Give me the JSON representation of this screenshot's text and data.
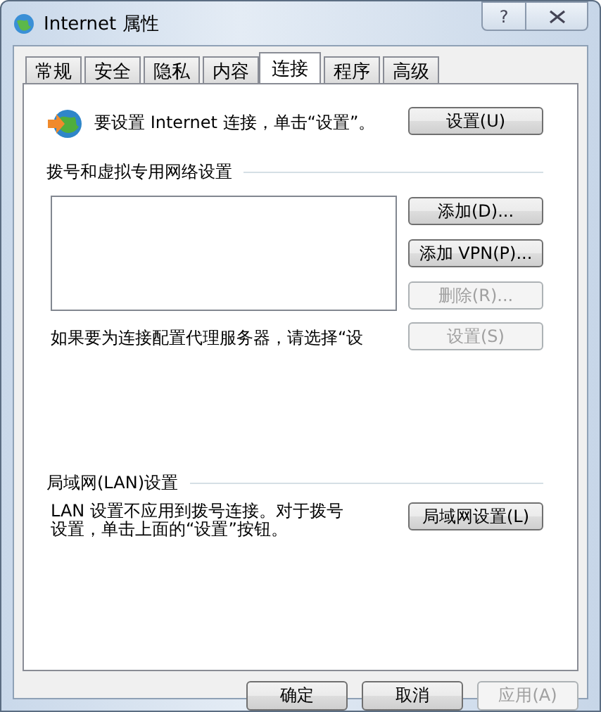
{
  "window": {
    "title": "Internet 属性",
    "help_button": "?"
  },
  "tabs": [
    {
      "label": "常规",
      "selected": false
    },
    {
      "label": "安全",
      "selected": false
    },
    {
      "label": "隐私",
      "selected": false
    },
    {
      "label": "内容",
      "selected": false
    },
    {
      "label": "连接",
      "selected": true
    },
    {
      "label": "程序",
      "selected": false
    },
    {
      "label": "高级",
      "selected": false
    }
  ],
  "setup": {
    "text": "要设置 Internet 连接，单击“设置”。",
    "button": {
      "label": "设置(U)",
      "disabled": false
    }
  },
  "dialup": {
    "heading": "拨号和虚拟专用网络设置",
    "buttons": [
      {
        "label": "添加(D)...",
        "disabled": false
      },
      {
        "label": "添加 VPN(P)...",
        "disabled": false
      },
      {
        "label": "删除(R)...",
        "disabled": true
      }
    ],
    "proxy_text": "如果要为连接配置代理服务器，请选择“设",
    "proxy_button": {
      "label": "设置(S)",
      "disabled": true
    }
  },
  "lan": {
    "heading": "局域网(LAN)设置",
    "text": "LAN 设置不应用到拨号连接。对于拨号设置，单击上面的“设置”按钮。",
    "button": {
      "label": "局域网设置(L)",
      "disabled": false
    }
  },
  "footer_buttons": [
    {
      "label": "确定",
      "disabled": false
    },
    {
      "label": "取消",
      "disabled": false
    },
    {
      "label": "应用(A)",
      "disabled": true
    }
  ]
}
